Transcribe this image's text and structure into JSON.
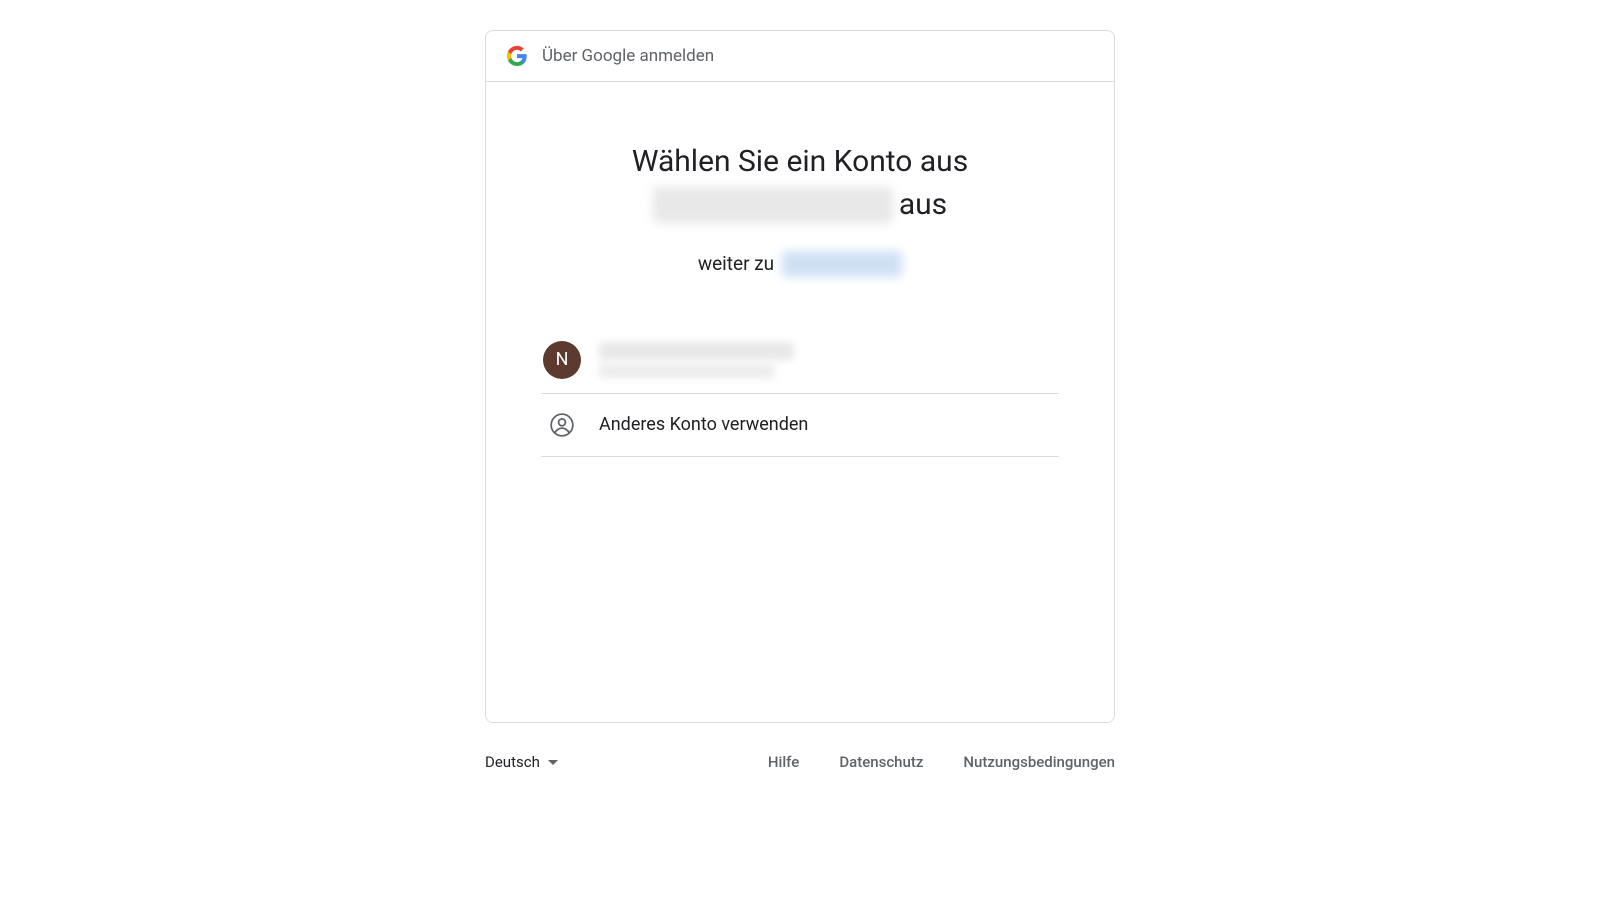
{
  "header": {
    "label": "Über Google anmelden"
  },
  "title": {
    "line1": "Wählen Sie ein Konto aus",
    "line2_suffix": "aus"
  },
  "subtitle": {
    "prefix": "weiter zu"
  },
  "accounts": [
    {
      "avatar_initial": "N",
      "avatar_bg": "#5d3a2e"
    }
  ],
  "other_account": {
    "label": "Anderes Konto verwenden"
  },
  "footer": {
    "language": "Deutsch",
    "links": {
      "help": "Hilfe",
      "privacy": "Datenschutz",
      "terms": "Nutzungsbedingungen"
    }
  }
}
